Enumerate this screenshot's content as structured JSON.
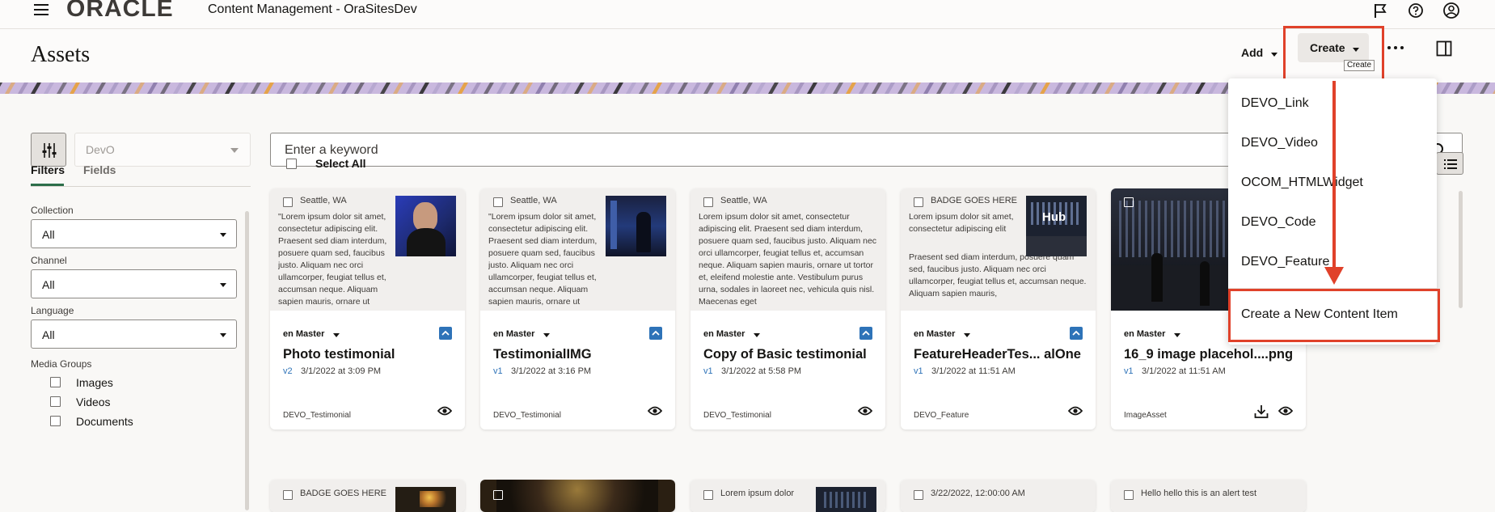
{
  "app": {
    "brand": "ORACLE",
    "title": "Content Management - OraSitesDev"
  },
  "header": {
    "page_title": "Assets",
    "add_label": "Add",
    "create_label": "Create",
    "create_tooltip": "Create"
  },
  "create_menu": {
    "items": [
      "DEVO_Link",
      "DEVO_Video",
      "OCOM_HTMLWidget",
      "DEVO_Code",
      "DEVO_Feature"
    ],
    "new_item": "Create a New Content Item"
  },
  "repository": {
    "value": "DevO"
  },
  "search": {
    "placeholder": "Enter a keyword"
  },
  "select_all": "Select All",
  "sidebar": {
    "tabs": [
      "Filters",
      "Fields"
    ],
    "collection_label": "Collection",
    "collection_value": "All",
    "channel_label": "Channel",
    "channel_value": "All",
    "language_label": "Language",
    "language_value": "All",
    "media_groups_label": "Media Groups",
    "media_groups": [
      "Images",
      "Videos",
      "Documents"
    ]
  },
  "cards": [
    {
      "location": "Seattle, WA",
      "preview_text": "\"Lorem ipsum dolor sit amet, consectetur adipiscing elit. Praesent sed diam interdum, posuere quam sed, faucibus justo. Aliquam nec orci ullamcorper, feugiat tellus et, accumsan neque. Aliquam sapien mauris, ornare ut tortor et, eleifend molestie ante.",
      "language": "en Master",
      "title": "Photo testimonial",
      "version": "v2",
      "date": "3/1/2022 at 3:09 PM",
      "type": "DEVO_Testimonial"
    },
    {
      "location": "Seattle, WA",
      "preview_text": "\"Lorem ipsum dolor sit amet, consectetur adipiscing elit. Praesent sed diam interdum, posuere quam sed, faucibus justo. Aliquam nec orci ullamcorper, feugiat tellus et, accumsan neque. Aliquam sapien mauris, ornare ut tortor et, eleifend molestie ante.",
      "language": "en Master",
      "title": "TestimonialIMG",
      "version": "v1",
      "date": "3/1/2022 at 3:16 PM",
      "type": "DEVO_Testimonial"
    },
    {
      "location": "Seattle, WA",
      "preview_text": "Lorem ipsum dolor sit amet, consectetur adipiscing elit. Praesent sed diam interdum, posuere quam sed, faucibus justo. Aliquam nec orci ullamcorper, feugiat tellus et, accumsan neque. Aliquam sapien mauris, ornare ut tortor et, eleifend molestie ante. Vestibulum purus urna, sodales in laoreet nec, vehicula quis nisl. Maecenas eget",
      "language": "en Master",
      "title": "Copy of Basic testimonial",
      "version": "v1",
      "date": "3/1/2022 at 5:58 PM",
      "type": "DEVO_Testimonial"
    },
    {
      "location": "BADGE GOES HERE",
      "preview_text": "Lorem ipsum dolor sit amet, consectetur adipiscing elit",
      "preview_text_2": "Praesent sed diam interdum, posuere quam sed, faucibus justo. Aliquam nec orci ullamcorper, feugiat tellus et, accumsan neque. Aliquam sapien mauris,",
      "language": "en Master",
      "title": "FeatureHeaderTes... alOne",
      "version": "v1",
      "date": "3/1/2022 at 11:51 AM",
      "type": "DEVO_Feature"
    },
    {
      "location": "",
      "preview_text": "",
      "language": "en Master",
      "title": "16_9 image placehol....png",
      "version": "v1",
      "date": "3/1/2022 at 11:51 AM",
      "type": "ImageAsset"
    }
  ],
  "row2": {
    "card1_location": "BADGE GOES HERE",
    "card3_location": "Lorem ipsum dolor",
    "card4_date": "3/22/2022, 12:00:00 AM",
    "card5_text": "Hello hello this is an alert test"
  },
  "colors": {
    "highlight_red": "#e0412a",
    "accent_blue": "#2e73b8",
    "banner_purple": "#c9b8de",
    "banner_orange": "#e8a13a"
  }
}
